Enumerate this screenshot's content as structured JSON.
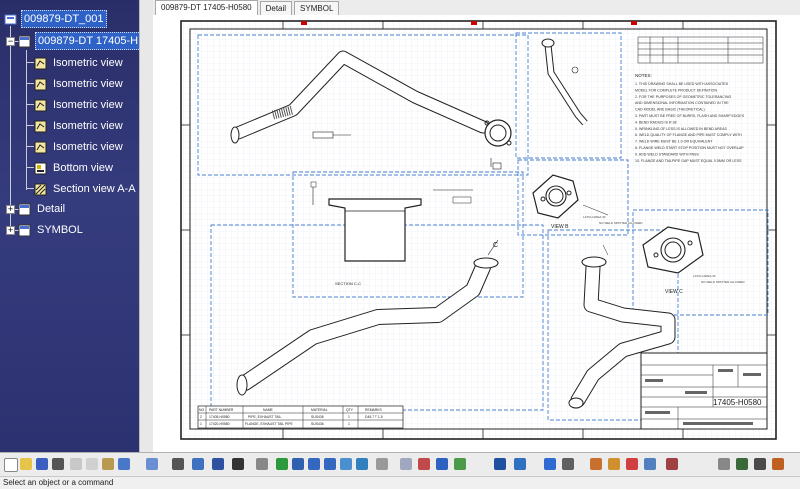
{
  "tree": {
    "root": "009879-DT_001",
    "sheet": "009879-DT  17405-H",
    "views": [
      "Isometric view",
      "Isometric view",
      "Isometric view",
      "Isometric view",
      "Isometric view",
      "Bottom view",
      "Section view A-A"
    ],
    "detail": "Detail",
    "symbol": "SYMBOL"
  },
  "tabs": [
    "009879-DT  17405-H0580",
    "Detail",
    "SYMBOL"
  ],
  "drawing": {
    "view_b": "VIEW B",
    "view_c": "VIEW C",
    "section_cc": "SECTION C-C",
    "c_marker": "C",
    "part_number": "17405-H0580",
    "notes_title": "NOTES:",
    "notes": [
      "1. THIS DRAWING SHALL BE USED WITH ASSOCIATED",
      "   MODEL FOR COMPLETE PRODUCT DEFINITION",
      "2. FOR THE PURPOSES OF GEOMETRIC TOLERANCING",
      "   AND DIMENSIONAL INFORMATION CONTAINED IN THE",
      "   CAD MODEL ARE BASIC (THEORETICAL)",
      "3. PART MUST BE FREE OF BURRS, FLASH AND SHARP EDGES",
      "4. BEND RADIUS IS R 38",
      "5. WRINKLING OF LESS IS ALLOWED IN BEND AREAS",
      "6. WELD QUALITY OF FLANGE AND PIPE MUST COMPLY WITH",
      "7. WELD WIRE MUST BE 1.0 OR EQUIVALENT",
      "8. FLANGE WELD START STOP POSITION MUST NOT OVERLAP",
      "9. ADD WELD STANDARD WITH PASS",
      "10. FLANGE AND TAILPIPE GAP MUST EQUAL 0.5MM OR LESS"
    ],
    "bom_headers": [
      "NO",
      "PART NUMBER",
      "NAME",
      "MATERIAL",
      "QTY",
      "REMARKS"
    ],
    "bom_rows": [
      [
        "2",
        "17405-H0580",
        "PIPE, EXHAUST TAIL",
        "SUS436",
        "1",
        "D45.7 T 1.5"
      ],
      [
        "1",
        "17420-H0580",
        "FLANGE, EXHAUST TAIL PIPE",
        "SUS436",
        "1",
        ""
      ]
    ]
  },
  "status": "Select an object or a command",
  "colors": {
    "tree_bg": "#2a2e68",
    "selection": "#2f62c6",
    "sheet_border": "#222222",
    "view_frame": "#4a7fd0"
  }
}
